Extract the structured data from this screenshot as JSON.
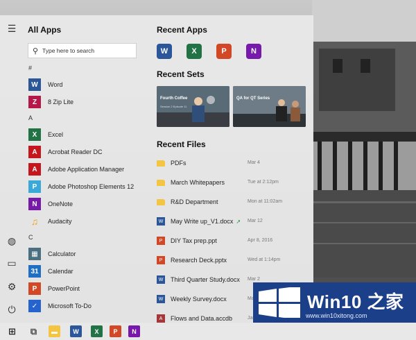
{
  "start_menu": {
    "all_apps_title": "All Apps",
    "search_placeholder": "Type here to search",
    "rail_icons": [
      "hamburger-menu-icon",
      "globe-icon",
      "pictures-icon",
      "settings-icon",
      "power-icon"
    ],
    "sections": [
      {
        "letter": "#",
        "apps": [
          {
            "label": "Word",
            "icon": "word-icon",
            "color": "#2b579a",
            "glyph": "W"
          },
          {
            "label": "8 Zip Lite",
            "icon": "8zip-icon",
            "color": "#b5174b",
            "glyph": "Z"
          }
        ]
      },
      {
        "letter": "A",
        "apps": [
          {
            "label": "Excel",
            "icon": "excel-icon",
            "color": "#217346",
            "glyph": "X"
          },
          {
            "label": "Acrobat Reader DC",
            "icon": "acrobat-icon",
            "color": "#c4161c",
            "glyph": "A"
          },
          {
            "label": "Adobe Application Manager",
            "icon": "adobe-app-manager-icon",
            "color": "#c4161c",
            "glyph": "A"
          },
          {
            "label": "Adobe Photoshop Elements 12",
            "icon": "photoshop-elements-icon",
            "color": "#3aa8d8",
            "glyph": "P"
          },
          {
            "label": "OneNote",
            "icon": "onenote-icon",
            "color": "#7719aa",
            "glyph": "N"
          },
          {
            "label": "Audacity",
            "icon": "audacity-icon",
            "color": "#f3a21a",
            "glyph": "♫"
          }
        ]
      },
      {
        "letter": "C",
        "apps": [
          {
            "label": "Calculator",
            "icon": "calculator-icon",
            "color": "#4a6f80",
            "glyph": "▦"
          },
          {
            "label": "Calendar",
            "icon": "calendar-icon",
            "color": "#1f6fc5",
            "glyph": "31"
          },
          {
            "label": "PowerPoint",
            "icon": "powerpoint-icon",
            "color": "#d24726",
            "glyph": "P"
          },
          {
            "label": "Microsoft To-Do",
            "icon": "todo-icon",
            "color": "#2564cf",
            "glyph": "✓"
          }
        ]
      }
    ]
  },
  "recent_apps": {
    "title": "Recent Apps",
    "apps": [
      {
        "icon": "word-icon",
        "color": "#2b579a",
        "glyph": "W"
      },
      {
        "icon": "excel-icon",
        "color": "#217346",
        "glyph": "X"
      },
      {
        "icon": "powerpoint-icon",
        "color": "#d24726",
        "glyph": "P"
      },
      {
        "icon": "onenote-icon",
        "color": "#7719aa",
        "glyph": "N"
      }
    ]
  },
  "recent_sets": {
    "title": "Recent Sets",
    "sets": [
      {
        "title": "Fourth Coffee",
        "subtitle": "Session 2 Episode 11"
      },
      {
        "title": "QA for QT Series",
        "subtitle": ""
      }
    ]
  },
  "recent_files": {
    "title": "Recent Files",
    "files": [
      {
        "name": "PDFs",
        "date": "Mar 4",
        "icon": "folder-icon",
        "color": "#f4c542",
        "glyph": ""
      },
      {
        "name": "March Whitepapers",
        "date": "Tue at 2:12pm",
        "icon": "folder-icon",
        "color": "#f4c542",
        "glyph": ""
      },
      {
        "name": "R&D Department",
        "date": "Mon at 11:02am",
        "icon": "folder-icon",
        "color": "#f4c542",
        "glyph": ""
      },
      {
        "name": "May Write up_V1.docx",
        "date": "Mar 12",
        "icon": "word-doc-icon",
        "color": "#2b579a",
        "glyph": "W",
        "trend": true
      },
      {
        "name": "DIY Tax prep.ppt",
        "date": "Apr 8, 2016",
        "icon": "powerpoint-doc-icon",
        "color": "#d24726",
        "glyph": "P"
      },
      {
        "name": "Research Deck.pptx",
        "date": "Wed at 1:14pm",
        "icon": "powerpoint-doc-icon",
        "color": "#d24726",
        "glyph": "P"
      },
      {
        "name": "Third Quarter Study.docx",
        "date": "Mar 2",
        "icon": "word-doc-icon",
        "color": "#2b579a",
        "glyph": "W"
      },
      {
        "name": "Weekly Survey.docx",
        "date": "Mar 1",
        "icon": "word-doc-icon",
        "color": "#2b579a",
        "glyph": "W"
      },
      {
        "name": "Flows and Data.accdb",
        "date": "Jan 5",
        "icon": "access-doc-icon",
        "color": "#a4373a",
        "glyph": "A"
      }
    ]
  },
  "taskbar": {
    "items": [
      {
        "icon": "windows-start-icon",
        "color": "#222",
        "glyph": "⊞"
      },
      {
        "icon": "task-view-icon",
        "color": "#555",
        "glyph": "⧉"
      },
      {
        "icon": "file-explorer-icon",
        "color": "#f4c542",
        "glyph": "▬"
      },
      {
        "icon": "word-icon",
        "color": "#2b579a",
        "glyph": "W"
      },
      {
        "icon": "excel-icon",
        "color": "#217346",
        "glyph": "X"
      },
      {
        "icon": "powerpoint-icon",
        "color": "#d24726",
        "glyph": "P"
      },
      {
        "icon": "onenote-icon",
        "color": "#7719aa",
        "glyph": "N"
      }
    ]
  },
  "watermark": {
    "title": "Win10 之家",
    "url": "www.win10xitong.com"
  }
}
